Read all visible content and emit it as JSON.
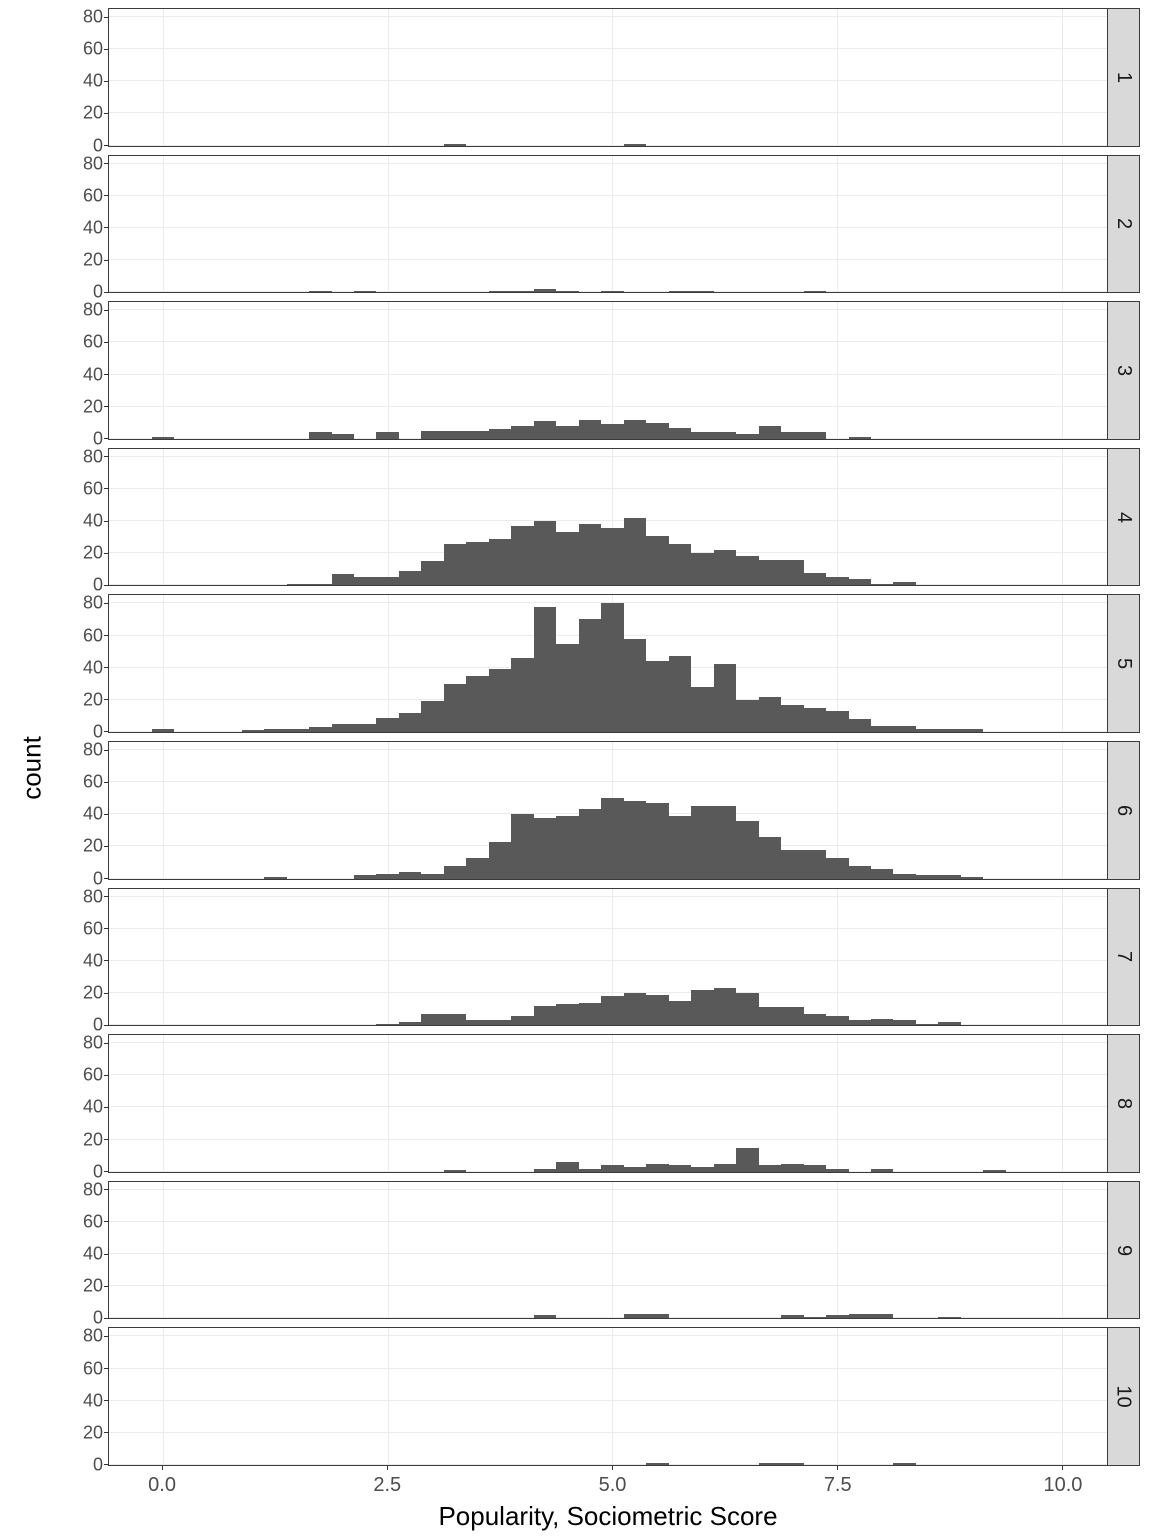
{
  "chart_data": {
    "type": "bar",
    "subtype": "faceted-histogram",
    "xlabel": "Popularity, Sociometric Score",
    "ylabel": "count",
    "xlim": [
      -0.6,
      10.5
    ],
    "ylim": [
      0,
      85
    ],
    "x_breaks": [
      0.0,
      2.5,
      5.0,
      7.5,
      10.0
    ],
    "y_breaks": [
      0,
      20,
      40,
      60,
      80
    ],
    "bin_width": 0.25,
    "bin_starts": [
      -0.125,
      0.125,
      0.375,
      0.625,
      0.875,
      1.125,
      1.375,
      1.625,
      1.875,
      2.125,
      2.375,
      2.625,
      2.875,
      3.125,
      3.375,
      3.625,
      3.875,
      4.125,
      4.375,
      4.625,
      4.875,
      5.125,
      5.375,
      5.625,
      5.875,
      6.125,
      6.375,
      6.625,
      6.875,
      7.125,
      7.375,
      7.625,
      7.875,
      8.125,
      8.375,
      8.625,
      8.875,
      9.125
    ],
    "facets": [
      {
        "label": "1",
        "counts": [
          0,
          0,
          0,
          0,
          0,
          0,
          0,
          0,
          0,
          0,
          0,
          0,
          0,
          1,
          0,
          0,
          0,
          0,
          0,
          0,
          0,
          1,
          0,
          0,
          0,
          0,
          0,
          0,
          0,
          0,
          0,
          0,
          0,
          0,
          0,
          0,
          0,
          0
        ]
      },
      {
        "label": "2",
        "counts": [
          0,
          0,
          0,
          0,
          0,
          0,
          0,
          1,
          0,
          1,
          0,
          0,
          0,
          0,
          0,
          1,
          1,
          2,
          1,
          0,
          1,
          0,
          0,
          1,
          1,
          0,
          0,
          0,
          0,
          1,
          0,
          0,
          0,
          0,
          0,
          0,
          0,
          0
        ]
      },
      {
        "label": "3",
        "counts": [
          1,
          0,
          0,
          0,
          0,
          0,
          0,
          4,
          3,
          0,
          4,
          0,
          5,
          5,
          5,
          6,
          8,
          11,
          8,
          12,
          9,
          12,
          10,
          7,
          4,
          4,
          3,
          8,
          4,
          4,
          0,
          1,
          0,
          0,
          0,
          0,
          0,
          0
        ]
      },
      {
        "label": "4",
        "counts": [
          0,
          0,
          0,
          0,
          0,
          0,
          1,
          1,
          7,
          5,
          5,
          9,
          15,
          26,
          27,
          29,
          37,
          40,
          33,
          38,
          36,
          42,
          31,
          26,
          20,
          22,
          18,
          16,
          16,
          8,
          5,
          4,
          1,
          2,
          0,
          0,
          0,
          0
        ]
      },
      {
        "label": "5",
        "counts": [
          2,
          0,
          0,
          0,
          1,
          2,
          2,
          3,
          5,
          5,
          9,
          12,
          19,
          30,
          35,
          39,
          46,
          78,
          55,
          70,
          80,
          58,
          44,
          47,
          28,
          42,
          20,
          22,
          17,
          15,
          13,
          8,
          4,
          4,
          2,
          2,
          2,
          0
        ]
      },
      {
        "label": "6",
        "counts": [
          0,
          0,
          0,
          0,
          0,
          1,
          0,
          0,
          0,
          2,
          3,
          4,
          3,
          8,
          13,
          23,
          40,
          38,
          39,
          43,
          50,
          48,
          47,
          39,
          45,
          45,
          36,
          26,
          18,
          18,
          13,
          8,
          6,
          3,
          2,
          2,
          1,
          0
        ]
      },
      {
        "label": "7",
        "counts": [
          0,
          0,
          0,
          0,
          0,
          0,
          0,
          0,
          0,
          0,
          1,
          2,
          7,
          7,
          3,
          3,
          6,
          12,
          13,
          14,
          18,
          20,
          19,
          15,
          22,
          23,
          20,
          11,
          11,
          7,
          6,
          3,
          4,
          3,
          1,
          2,
          0,
          0
        ]
      },
      {
        "label": "8",
        "counts": [
          0,
          0,
          0,
          0,
          0,
          0,
          0,
          0,
          0,
          0,
          0,
          0,
          0,
          1,
          0,
          0,
          0,
          2,
          6,
          2,
          4,
          3,
          5,
          4,
          3,
          5,
          15,
          4,
          5,
          4,
          2,
          0,
          2,
          0,
          0,
          0,
          0,
          1
        ]
      },
      {
        "label": "9",
        "counts": [
          0,
          0,
          0,
          0,
          0,
          0,
          0,
          0,
          0,
          0,
          0,
          0,
          0,
          0,
          0,
          0,
          0,
          2,
          0,
          0,
          0,
          3,
          3,
          0,
          0,
          0,
          0,
          0,
          2,
          1,
          2,
          3,
          3,
          0,
          0,
          1,
          0,
          0
        ]
      },
      {
        "label": "10",
        "counts": [
          0,
          0,
          0,
          0,
          0,
          0,
          0,
          0,
          0,
          0,
          0,
          0,
          0,
          0,
          0,
          0,
          0,
          0,
          0,
          0,
          0,
          0,
          1,
          0,
          0,
          0,
          0,
          1,
          1,
          0,
          0,
          0,
          0,
          1,
          0,
          0,
          0,
          0
        ]
      }
    ]
  },
  "x_tick_labels": [
    "0.0",
    "2.5",
    "5.0",
    "7.5",
    "10.0"
  ]
}
